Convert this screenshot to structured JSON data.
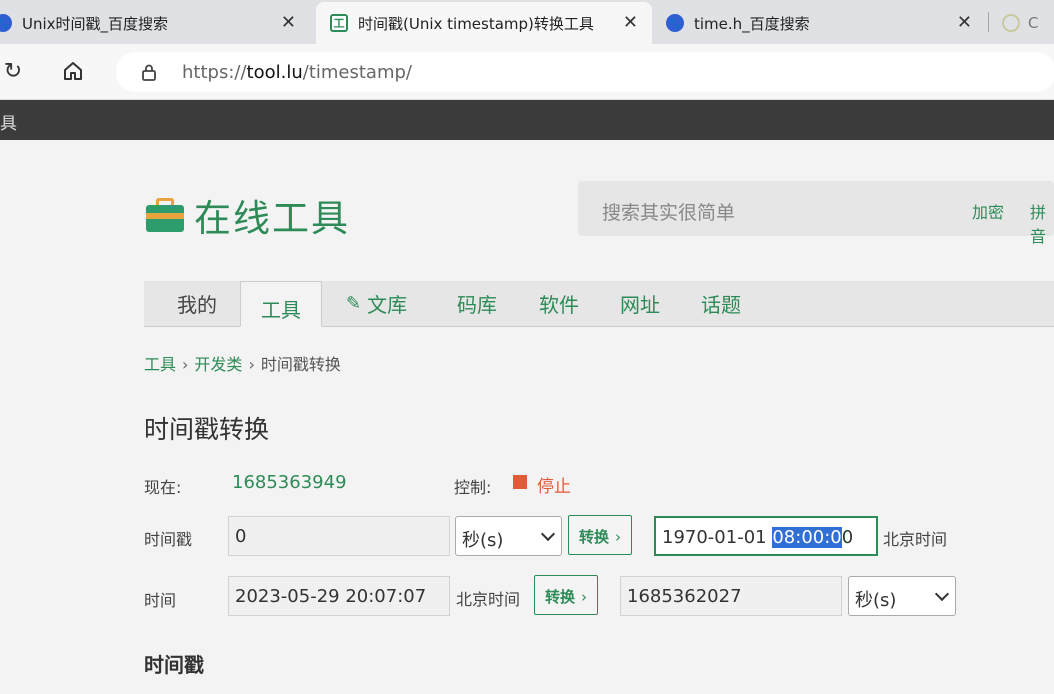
{
  "browser": {
    "tabs": [
      {
        "title": "Unix时间戳_百度搜索",
        "favicon": "baidu-paw-icon"
      },
      {
        "title": "时间戳(Unix timestamp)转换工具",
        "favicon": "tool-lu-icon"
      },
      {
        "title": "time.h_百度搜索",
        "favicon": "baidu-paw-icon"
      },
      {
        "title": "C",
        "favicon": "globe-icon"
      }
    ],
    "close_glyph": "✕",
    "url_prefix": "https://",
    "url_host": "tool.lu",
    "url_path": "/timestamp/"
  },
  "sitebar": {
    "text": "具"
  },
  "header": {
    "logo_text": "在线工具",
    "search_placeholder": "搜索其实很简单",
    "quick_links": [
      "加密",
      "拼音"
    ]
  },
  "nav": {
    "items": [
      "我的",
      "工具",
      "文库",
      "码库",
      "软件",
      "网址",
      "话题"
    ]
  },
  "breadcrumb": {
    "items": [
      "工具",
      "开发类",
      "时间戳转换"
    ],
    "separator": "›"
  },
  "page": {
    "title": "时间戳转换",
    "now_label": "现在:",
    "now_value": "1685363949",
    "control_label": "控制:",
    "stop_label": "停止",
    "row1": {
      "label": "时间戳",
      "input_value": "0",
      "unit": "秒(s)",
      "convert_label": "转换",
      "arrow": "›",
      "result_before": "1970-01-01 ",
      "result_selected": "08:00:0",
      "result_after": "0",
      "tz_label": "北京时间"
    },
    "row2": {
      "label": "时间",
      "input_value": "2023-05-29 20:07:07",
      "tz_label": "北京时间",
      "convert_label": "转换",
      "arrow": "›",
      "result_value": "1685362027",
      "unit": "秒(s)"
    },
    "section_heading": "时间戳"
  },
  "colors": {
    "accent": "#2e8b57",
    "stop": "#e05b3a",
    "selection": "#2f6fd6"
  }
}
